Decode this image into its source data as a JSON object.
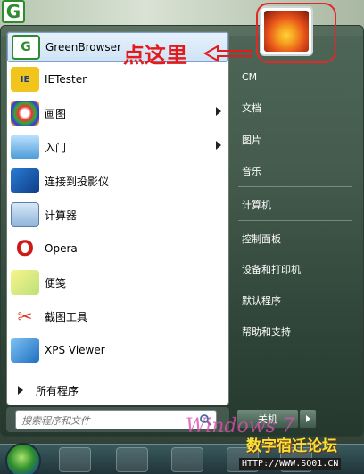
{
  "desktop": {
    "app_icon_letter": "G"
  },
  "annotation": {
    "text": "点这里"
  },
  "programs": [
    {
      "label": "GreenBrowser",
      "icon": "greenbrowser-icon",
      "has_submenu": false,
      "selected": true
    },
    {
      "label": "IETester",
      "icon": "ietester-icon",
      "has_submenu": false,
      "selected": false
    },
    {
      "label": "画图",
      "icon": "paint-icon",
      "has_submenu": true,
      "selected": false
    },
    {
      "label": "入门",
      "icon": "getting-started-icon",
      "has_submenu": true,
      "selected": false
    },
    {
      "label": "连接到投影仪",
      "icon": "projector-icon",
      "has_submenu": false,
      "selected": false
    },
    {
      "label": "计算器",
      "icon": "calculator-icon",
      "has_submenu": false,
      "selected": false
    },
    {
      "label": "Opera",
      "icon": "opera-icon",
      "has_submenu": false,
      "selected": false
    },
    {
      "label": "便笺",
      "icon": "sticky-notes-icon",
      "has_submenu": false,
      "selected": false
    },
    {
      "label": "截图工具",
      "icon": "snipping-tool-icon",
      "has_submenu": false,
      "selected": false
    },
    {
      "label": "XPS Viewer",
      "icon": "xps-viewer-icon",
      "has_submenu": false,
      "selected": false
    }
  ],
  "all_programs_label": "所有程序",
  "search": {
    "placeholder": "搜索程序和文件"
  },
  "right_pane": [
    {
      "label": "CM"
    },
    {
      "label": "文档"
    },
    {
      "label": "图片"
    },
    {
      "label": "音乐"
    },
    {
      "label": "计算机"
    },
    {
      "label": "控制面板"
    },
    {
      "label": "设备和打印机"
    },
    {
      "label": "默认程序"
    },
    {
      "label": "帮助和支持"
    }
  ],
  "shutdown_label": "关机",
  "watermarks": {
    "windows": "Windows 7",
    "site_name": "数字宿迁论坛",
    "site_url": "HTTP://WWW.SQ01.CN"
  },
  "colors": {
    "annotation_red": "#e41b1b",
    "selected_highlight": "#cfe3f7",
    "greenbrowser_green": "#2e8b2e",
    "opera_red": "#cc1a1a"
  }
}
